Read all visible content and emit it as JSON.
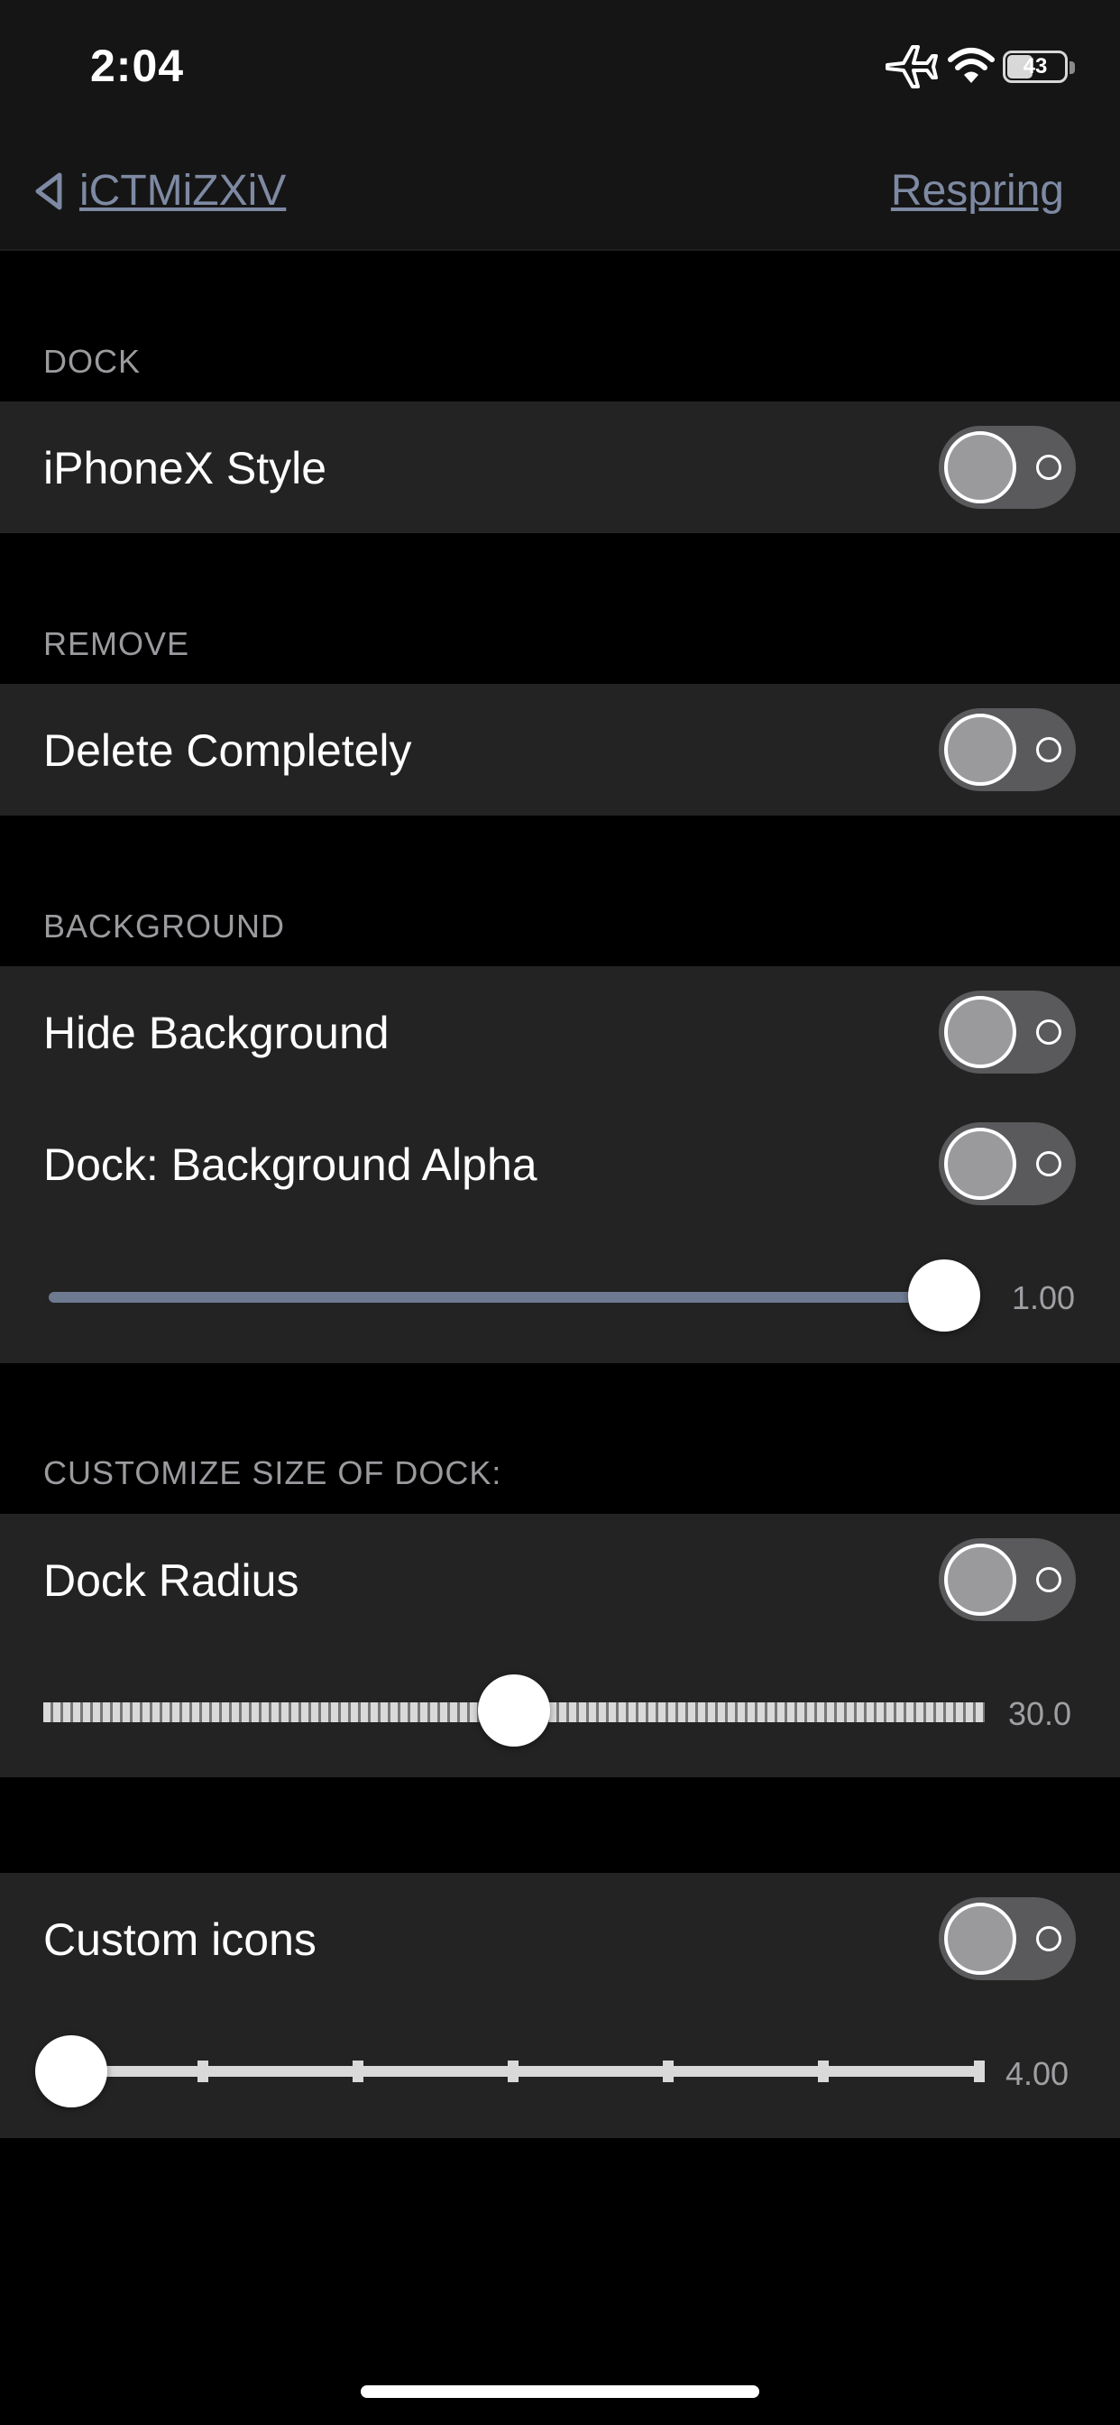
{
  "status_bar": {
    "time": "2:04",
    "battery": "43",
    "icons": [
      "airplane-icon",
      "wifi-icon",
      "battery-icon"
    ]
  },
  "nav": {
    "back_label": "iCTMiZXiV",
    "action_label": "Respring"
  },
  "colors": {
    "background": "#000000",
    "group_background": "#232323",
    "link": "#7e8aa3",
    "toggle_off": "#5a5a5d",
    "slider_fill": "#6e7a90"
  },
  "sections": {
    "dock": {
      "header": "DOCK",
      "rows": {
        "iphonex_style": {
          "label": "iPhoneX Style",
          "on": false
        }
      }
    },
    "remove": {
      "header": "REMOVE",
      "rows": {
        "delete_completely": {
          "label": "Delete Completely",
          "on": false
        }
      }
    },
    "background": {
      "header": "BACKGROUND",
      "rows": {
        "hide_background": {
          "label": "Hide Background",
          "on": false
        },
        "background_alpha": {
          "label": "Dock: Background Alpha",
          "on": false
        }
      },
      "alpha_slider": {
        "value": "1.00",
        "fraction": 1.0
      }
    },
    "size": {
      "header": "CUSTOMIZE SIZE OF DOCK:",
      "rows": {
        "dock_radius": {
          "label": "Dock Radius",
          "on": false
        }
      },
      "radius_slider": {
        "value": "30.0",
        "fraction": 0.5
      }
    },
    "icons": {
      "rows": {
        "custom_icons": {
          "label": "Custom icons",
          "on": false
        }
      },
      "icons_slider": {
        "value": "4.00",
        "fraction": 0.0
      }
    }
  }
}
